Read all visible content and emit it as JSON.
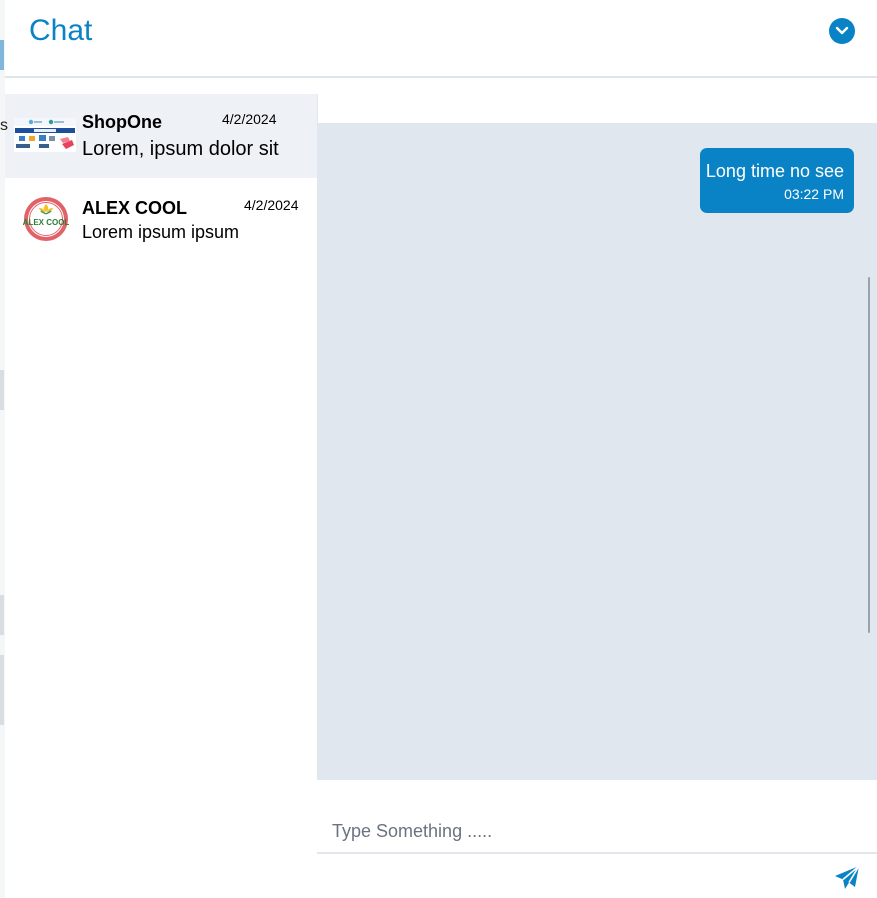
{
  "header": {
    "title": "Chat",
    "collapse_icon": "chevron-down-icon",
    "accent_color": "#0a83c6"
  },
  "edge": {
    "letter": "s"
  },
  "conversations": [
    {
      "name": "ShopOne",
      "date": "4/2/2024",
      "preview": "Lorem, ipsum dolor sit",
      "avatar": "shop-banner-thumbnail",
      "active": true
    },
    {
      "name": "ALEX COOL",
      "date": "4/2/2024",
      "preview": "Lorem ipsum ipsum",
      "avatar": "alex-cool-logo",
      "avatar_text": "ALEX COOL",
      "active": false
    }
  ],
  "messages": [
    {
      "text": "Long time no see",
      "time": "03:22 PM",
      "direction": "outgoing",
      "color": "#0a83c6"
    }
  ],
  "composer": {
    "placeholder": "Type Something .....",
    "value": "",
    "send_icon": "paper-plane-icon"
  },
  "colors": {
    "messages_background": "#e1e7ef",
    "active_conversation_background": "#eef2f7"
  }
}
